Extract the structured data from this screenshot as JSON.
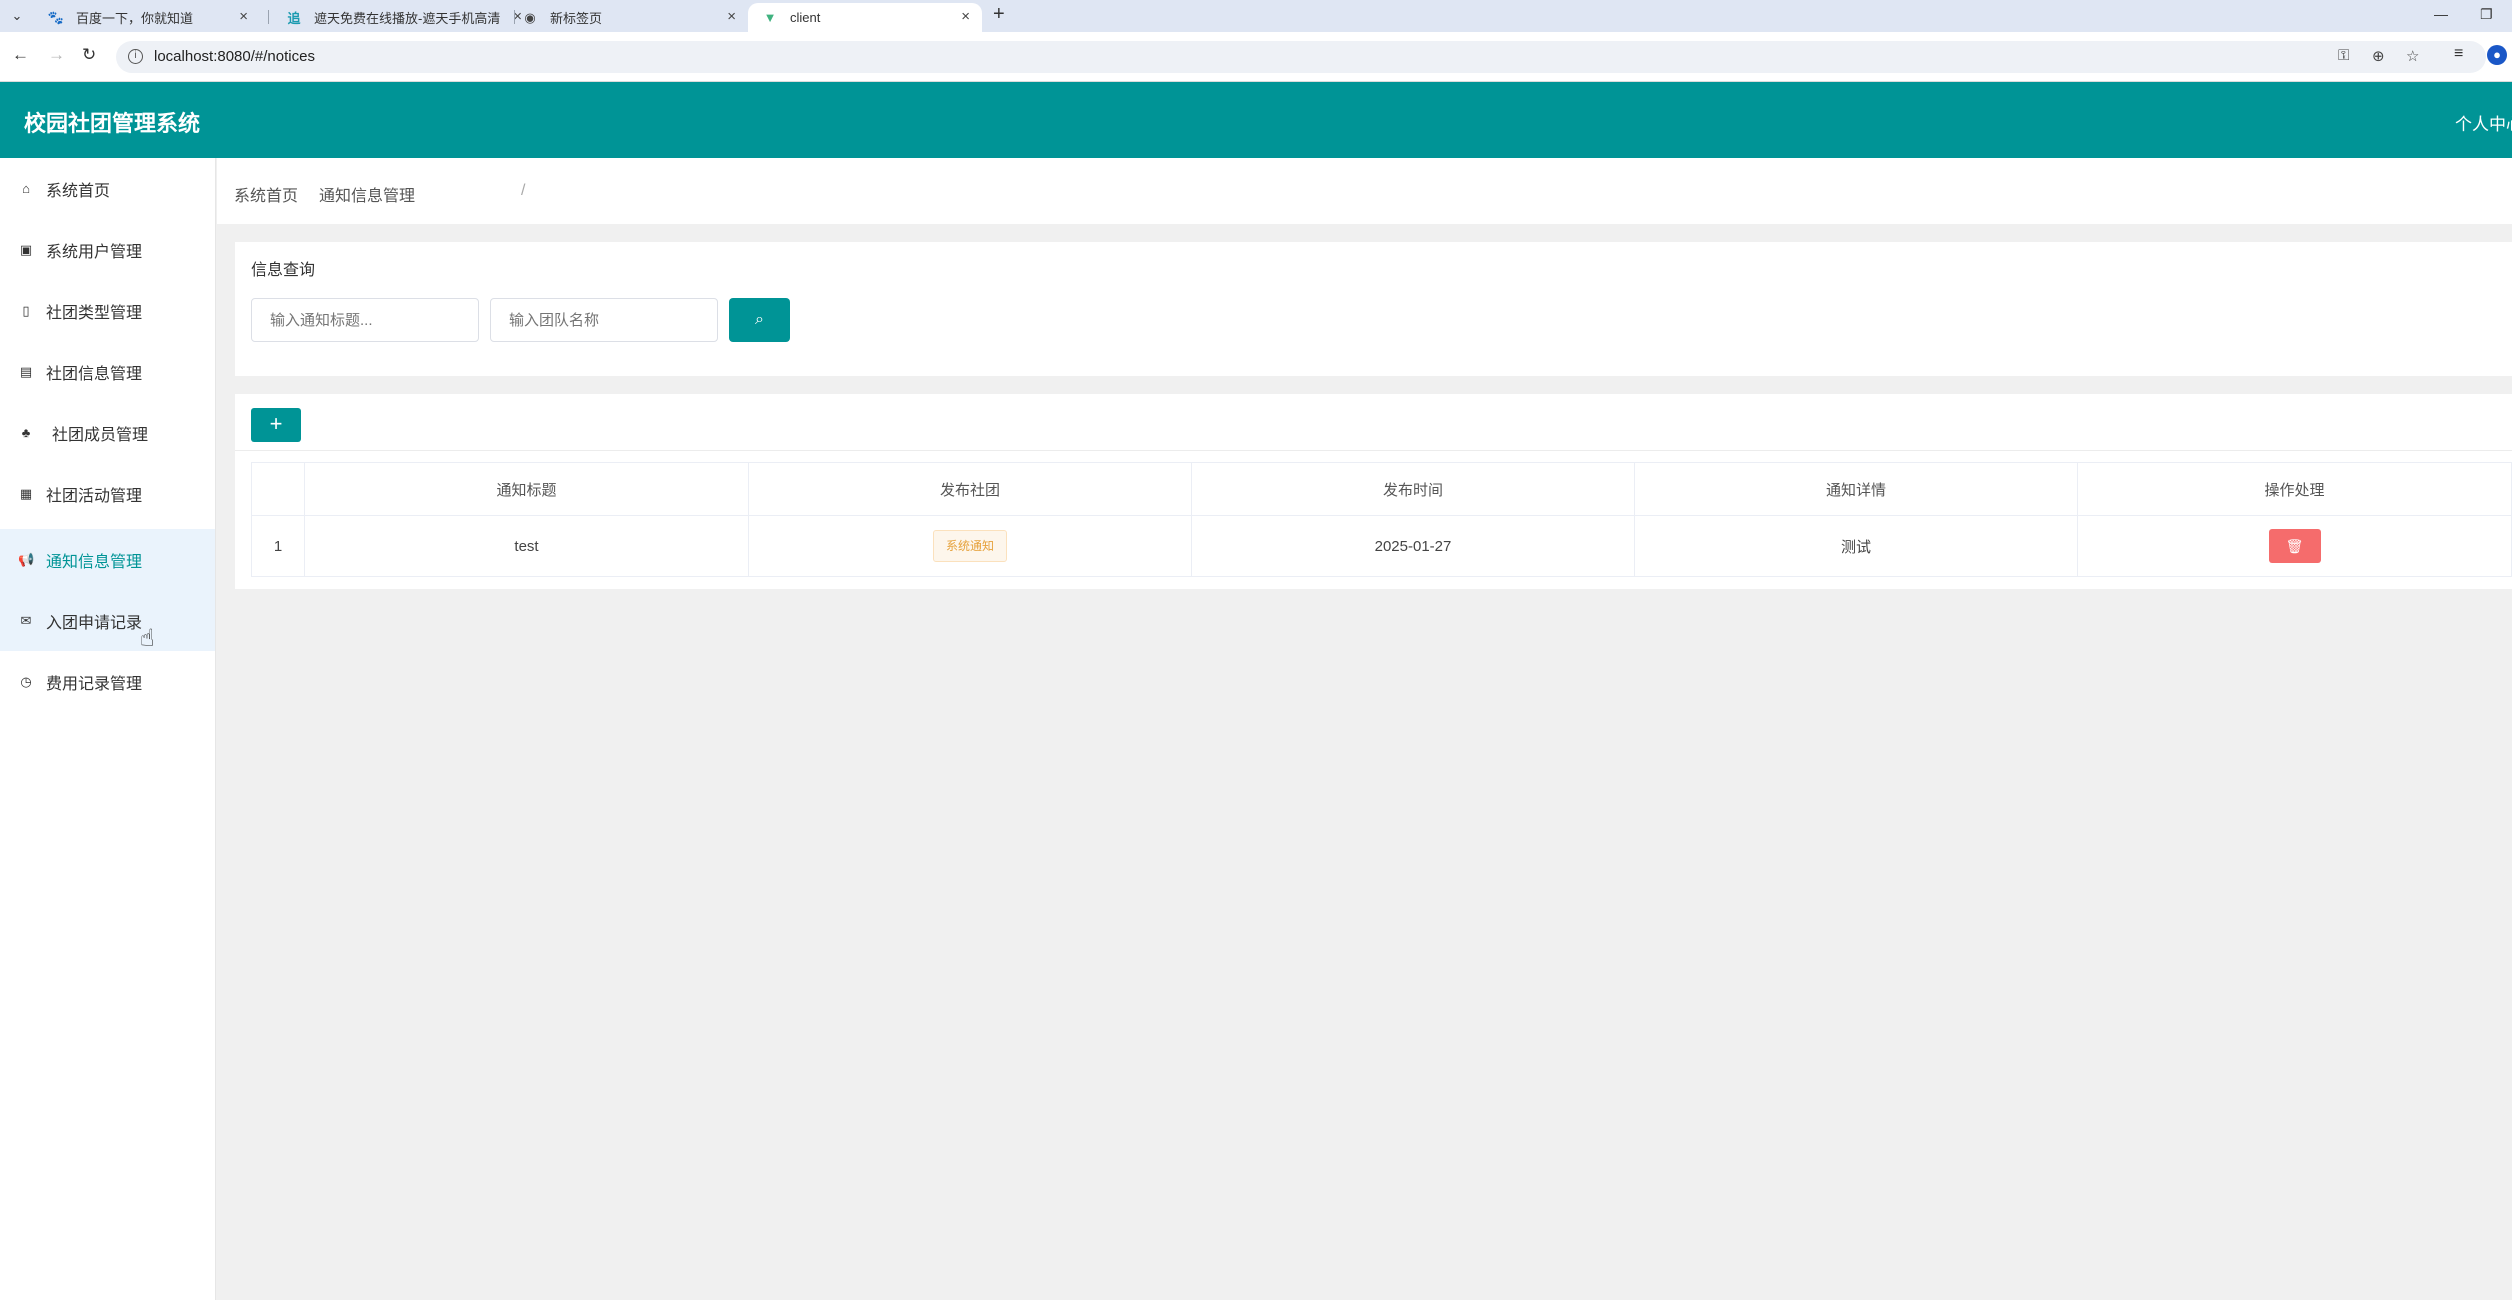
{
  "browser": {
    "tabs": [
      {
        "title": "百度一下，你就知道",
        "icon": "baidu-icon"
      },
      {
        "title": "遮天免费在线播放-遮天手机高清",
        "icon": "video-site-icon"
      },
      {
        "title": "新标签页",
        "icon": "chrome-icon"
      },
      {
        "title": "client",
        "icon": "vue-icon"
      }
    ],
    "active_tab": 3,
    "url": "localhost:8080/#/notices"
  },
  "header": {
    "title": "校园社团管理系统",
    "user_center": "个人中心"
  },
  "sidebar": {
    "items": [
      {
        "label": "系统首页",
        "icon": "home-icon"
      },
      {
        "label": "系统用户管理",
        "icon": "user-card-icon"
      },
      {
        "label": "社团类型管理",
        "icon": "building-icon"
      },
      {
        "label": "社团信息管理",
        "icon": "train-icon"
      },
      {
        "label": "社团成员管理",
        "icon": "users-icon"
      },
      {
        "label": "社团活动管理",
        "icon": "calculator-icon"
      },
      {
        "label": "通知信息管理",
        "icon": "bullhorn-icon"
      },
      {
        "label": "入团申请记录",
        "icon": "envelope-open-icon"
      },
      {
        "label": "费用记录管理",
        "icon": "clock-icon"
      }
    ],
    "active_index": 6,
    "hover_index": 7
  },
  "breadcrumb": {
    "home": "系统首页",
    "separator": "/",
    "current": "通知信息管理"
  },
  "query": {
    "title": "信息查询",
    "title_placeholder": "输入通知标题...",
    "team_placeholder": "输入团队名称"
  },
  "table": {
    "add_label": "+",
    "columns": [
      "",
      "通知标题",
      "发布社团",
      "发布时间",
      "通知详情",
      "操作处理"
    ],
    "rows": [
      {
        "index": "1",
        "title": "test",
        "club": "系统通知",
        "time": "2025-01-27",
        "detail": "测试"
      }
    ]
  },
  "colors": {
    "primary": "#009496",
    "danger": "#f56c6c",
    "tag_warning": "#e6a23c",
    "active_bg": "#eaf3fc"
  }
}
